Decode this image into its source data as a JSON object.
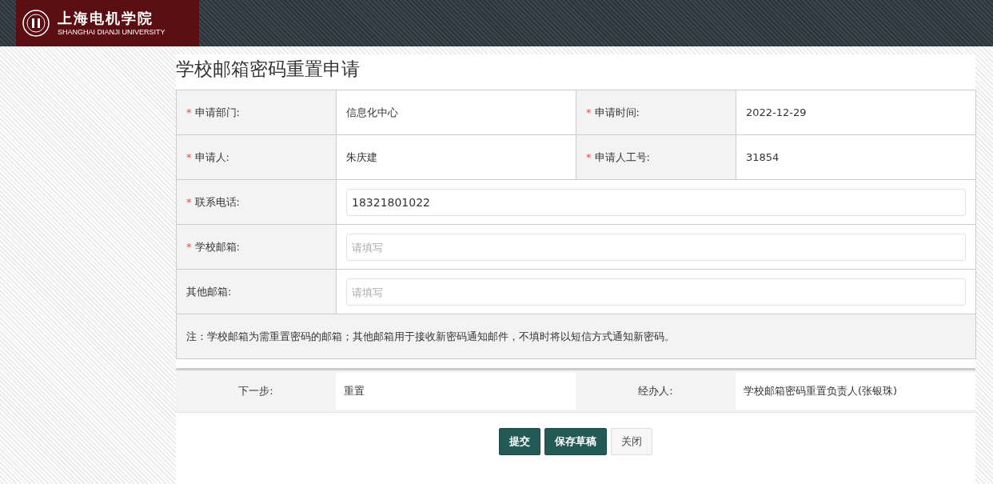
{
  "header": {
    "logo_cn": "上海电机学院",
    "logo_en": "SHANGHAI DIANJI UNIVERSITY"
  },
  "form": {
    "title": "学校邮箱密码重置申请",
    "fields": [
      {
        "kind": "text",
        "mark": "*",
        "label": "申请部门:",
        "value": "信息化中心"
      },
      {
        "kind": "text",
        "mark": "*",
        "label": "申请时间:",
        "value": "2022-12-29"
      },
      {
        "kind": "text",
        "mark": "*",
        "label": "申请人:",
        "value": "朱庆建"
      },
      {
        "kind": "text",
        "mark": "*",
        "label": "申请人工号:",
        "value": "31854"
      },
      {
        "kind": "input",
        "mark": "*",
        "label": "联系电话:",
        "value": "18321801022"
      },
      {
        "kind": "input",
        "mark": "*",
        "label": "学校邮箱:",
        "placeholder": "请填写"
      },
      {
        "kind": "input",
        "label": "其他邮箱:",
        "placeholder": "请填写"
      }
    ],
    "note": "注：学校邮箱为需重置密码的邮箱；其他邮箱用于接收新密码通知邮件，不填时将以短信方式通知新密码。"
  },
  "flow": {
    "next_label": "下一步:",
    "next_value": "重置",
    "handler_label": "经办人:",
    "handler_value": "学校邮箱密码重置负责人(张银珠)"
  },
  "buttons": [
    {
      "label": "提交",
      "kind": "primary"
    },
    {
      "label": "保存草稿",
      "kind": "primary"
    },
    {
      "label": "关闭",
      "kind": "default"
    }
  ]
}
